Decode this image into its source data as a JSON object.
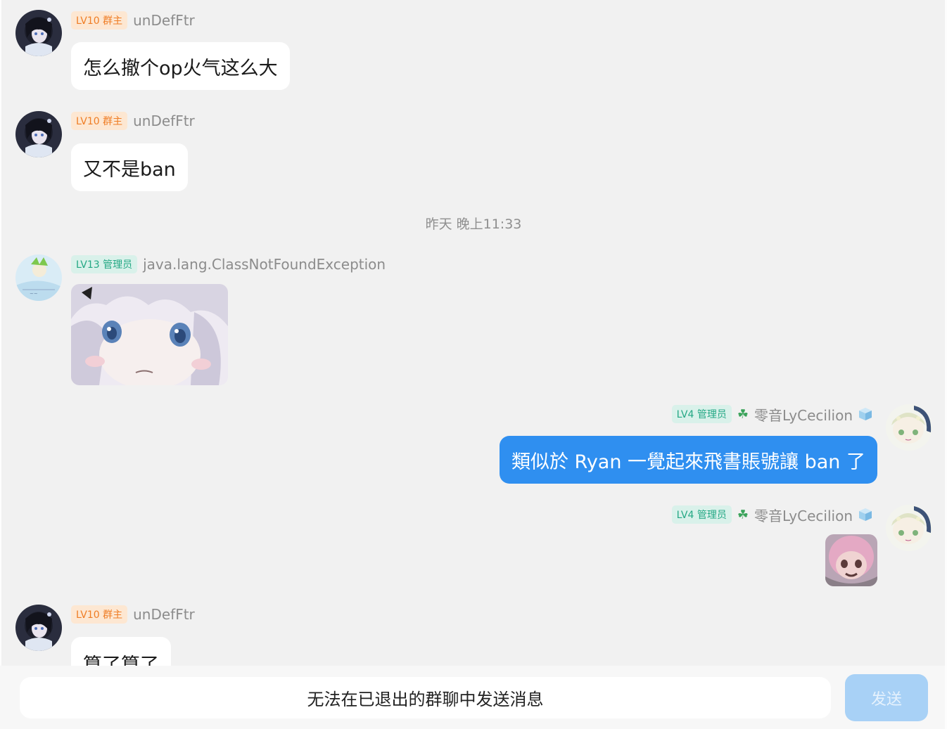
{
  "messages": [
    {
      "badge": "LV10 群主",
      "nick": "unDefFtr",
      "text": "怎么撤个op火气这么大"
    },
    {
      "badge": "LV10 群主",
      "nick": "unDefFtr",
      "text": "又不是ban"
    },
    {
      "timestamp": "昨天 晚上11:33"
    },
    {
      "badge": "LV13 管理员",
      "nick": "java.lang.ClassNotFoundException",
      "type": "image"
    },
    {
      "badge": "LV4 管理员",
      "nick": "零音LyCecilion",
      "text": "類似於 Ryan 一覺起來飛書賬號讓 ban 了",
      "mine": true
    },
    {
      "badge": "LV4 管理员",
      "nick": "零音LyCecilion",
      "type": "image",
      "mine": true
    },
    {
      "badge": "LV10 群主",
      "nick": "unDefFtr",
      "text": "算了算了"
    }
  ],
  "input": {
    "disabled_text": "无法在已退出的群聊中发送消息"
  },
  "send": {
    "label": "发送"
  },
  "colors": {
    "accent": "#2f8ff0",
    "owner_badge": "#ef7d25",
    "admin_badge": "#24a884",
    "send_disabled": "#a8d1f6"
  },
  "icons": [
    "clover-icon",
    "ice-cube-icon"
  ]
}
